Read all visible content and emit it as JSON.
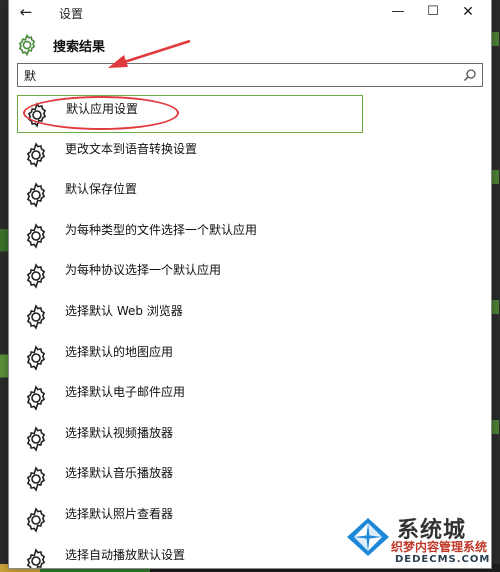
{
  "window": {
    "title": "设置",
    "back_label": "←",
    "minimize_label": "—",
    "maximize_label": "☐",
    "close_label": "✕"
  },
  "header": {
    "title": "搜索结果",
    "icon": "gear-icon"
  },
  "search": {
    "value": "默",
    "icon": "search-icon"
  },
  "results": [
    {
      "label": "默认应用设置",
      "selected": true
    },
    {
      "label": "更改文本到语音转换设置"
    },
    {
      "label": "默认保存位置"
    },
    {
      "label": "为每种类型的文件选择一个默认应用"
    },
    {
      "label": "为每种协议选择一个默认应用"
    },
    {
      "label": "选择默认 Web 浏览器"
    },
    {
      "label": "选择默认的地图应用"
    },
    {
      "label": "选择默认电子邮件应用"
    },
    {
      "label": "选择默认视频播放器"
    },
    {
      "label": "选择默认音乐播放器"
    },
    {
      "label": "选择默认照片查看器"
    },
    {
      "label": "选择自动播放默认设置"
    }
  ],
  "watermark": {
    "title": "系统城",
    "subtitle": "织梦内容管理系统",
    "url": "DEDECMS.COM"
  },
  "colors": {
    "selection_border": "#6aa842",
    "annotation_red": "#e0393e"
  }
}
